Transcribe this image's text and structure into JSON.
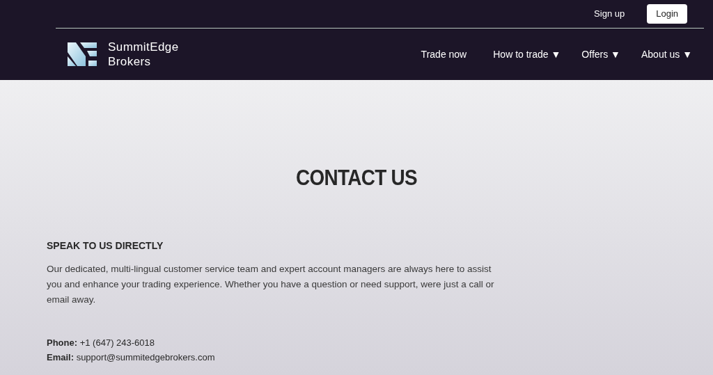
{
  "top_bar": {
    "links": [
      {
        "label": "Sign up",
        "kind": "link"
      },
      {
        "label": "Login",
        "kind": "button"
      }
    ]
  },
  "logo": {
    "lines": [
      "SummitEdge",
      "Brokers"
    ]
  },
  "nav": [
    {
      "label": "Trade now",
      "has_menu": false
    },
    {
      "label": "How to trade",
      "has_menu": true
    },
    {
      "label": "Offers",
      "has_menu": true
    },
    {
      "label": "About us",
      "has_menu": true
    }
  ],
  "menu_caret": "▼",
  "title": "CONTACT US",
  "section": {
    "heading": "SPEAK TO US DIRECTLY",
    "text": "Our dedicated, multi-lingual customer service team and expert account managers are always here to assist you and enhance your trading experience. Whether you have a question or need support, were just a call or email away.",
    "contacts": [
      "**Phone:** +1 (647) 243-6018",
      "**Email:** support@summitedgebrokers.com"
    ]
  }
}
